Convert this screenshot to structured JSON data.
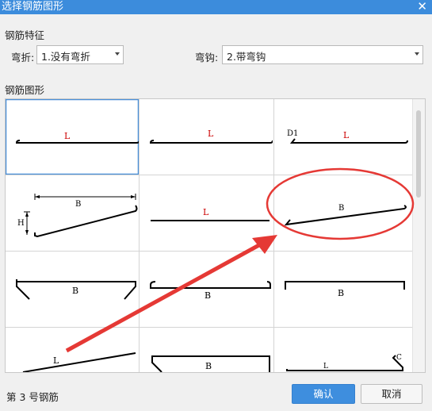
{
  "window": {
    "title": "选择钢筋图形",
    "close_icon": "close-icon"
  },
  "features": {
    "section_title": "钢筋特征",
    "bend_label": "弯折:",
    "bend_value": "1.没有弯折",
    "hook_label": "弯钩:",
    "hook_value": "2.带弯钩"
  },
  "shapes": {
    "section_title": "钢筋图形",
    "cells": [
      {
        "labels": [
          "L"
        ],
        "selected": true
      },
      {
        "labels": [
          "L"
        ]
      },
      {
        "labels": [
          "D1",
          "L"
        ]
      },
      {
        "labels": [
          "B",
          "H"
        ]
      },
      {
        "labels": [
          "L"
        ]
      },
      {
        "labels": [
          "B"
        ]
      },
      {
        "labels": [
          "B"
        ]
      },
      {
        "labels": [
          "B"
        ]
      },
      {
        "labels": [
          "B"
        ]
      },
      {
        "labels": [
          "L"
        ]
      },
      {
        "labels": [
          "B"
        ]
      },
      {
        "labels": [
          "L",
          "C"
        ]
      }
    ]
  },
  "status_text": "第 3 号钢筋",
  "buttons": {
    "ok": "确认",
    "cancel": "取消"
  },
  "colors": {
    "titlebar": "#3c8cdc",
    "selection": "#4a90d9",
    "annotation": "#e53935",
    "dim_red": "#cc0000",
    "ok_button": "#3e8ede"
  }
}
